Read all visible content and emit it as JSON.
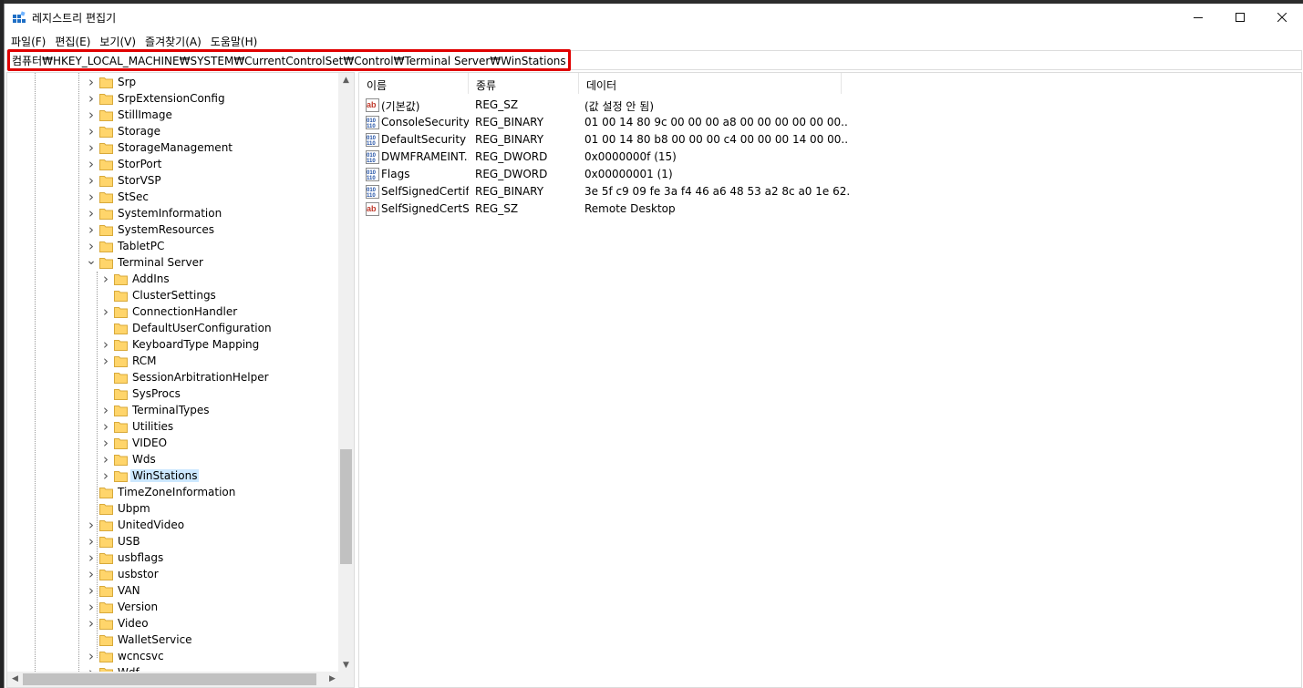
{
  "window": {
    "title": "레지스트리 편집기"
  },
  "menu": [
    "파일(F)",
    "편집(E)",
    "보기(V)",
    "즐겨찾기(A)",
    "도움말(H)"
  ],
  "address": "컴퓨터₩HKEY_LOCAL_MACHINE₩SYSTEM₩CurrentControlSet₩Control₩Terminal Server₩WinStations",
  "tree": [
    {
      "label": "Srp",
      "level": 1,
      "expander": "collapsed"
    },
    {
      "label": "SrpExtensionConfig",
      "level": 1,
      "expander": "collapsed"
    },
    {
      "label": "StillImage",
      "level": 1,
      "expander": "collapsed"
    },
    {
      "label": "Storage",
      "level": 1,
      "expander": "collapsed"
    },
    {
      "label": "StorageManagement",
      "level": 1,
      "expander": "collapsed"
    },
    {
      "label": "StorPort",
      "level": 1,
      "expander": "collapsed"
    },
    {
      "label": "StorVSP",
      "level": 1,
      "expander": "collapsed"
    },
    {
      "label": "StSec",
      "level": 1,
      "expander": "collapsed"
    },
    {
      "label": "SystemInformation",
      "level": 1,
      "expander": "collapsed"
    },
    {
      "label": "SystemResources",
      "level": 1,
      "expander": "collapsed"
    },
    {
      "label": "TabletPC",
      "level": 1,
      "expander": "collapsed"
    },
    {
      "label": "Terminal Server",
      "level": 1,
      "expander": "expanded"
    },
    {
      "label": "AddIns",
      "level": 2,
      "expander": "collapsed"
    },
    {
      "label": "ClusterSettings",
      "level": 2,
      "expander": "none"
    },
    {
      "label": "ConnectionHandler",
      "level": 2,
      "expander": "collapsed"
    },
    {
      "label": "DefaultUserConfiguration",
      "level": 2,
      "expander": "none"
    },
    {
      "label": "KeyboardType Mapping",
      "level": 2,
      "expander": "collapsed"
    },
    {
      "label": "RCM",
      "level": 2,
      "expander": "collapsed"
    },
    {
      "label": "SessionArbitrationHelper",
      "level": 2,
      "expander": "none"
    },
    {
      "label": "SysProcs",
      "level": 2,
      "expander": "none"
    },
    {
      "label": "TerminalTypes",
      "level": 2,
      "expander": "collapsed"
    },
    {
      "label": "Utilities",
      "level": 2,
      "expander": "collapsed"
    },
    {
      "label": "VIDEO",
      "level": 2,
      "expander": "collapsed"
    },
    {
      "label": "Wds",
      "level": 2,
      "expander": "collapsed"
    },
    {
      "label": "WinStations",
      "level": 2,
      "expander": "collapsed",
      "selected": true
    },
    {
      "label": "TimeZoneInformation",
      "level": 1,
      "expander": "none"
    },
    {
      "label": "Ubpm",
      "level": 1,
      "expander": "none"
    },
    {
      "label": "UnitedVideo",
      "level": 1,
      "expander": "collapsed"
    },
    {
      "label": "USB",
      "level": 1,
      "expander": "collapsed"
    },
    {
      "label": "usbflags",
      "level": 1,
      "expander": "collapsed"
    },
    {
      "label": "usbstor",
      "level": 1,
      "expander": "collapsed"
    },
    {
      "label": "VAN",
      "level": 1,
      "expander": "collapsed"
    },
    {
      "label": "Version",
      "level": 1,
      "expander": "collapsed"
    },
    {
      "label": "Video",
      "level": 1,
      "expander": "collapsed"
    },
    {
      "label": "WalletService",
      "level": 1,
      "expander": "none"
    },
    {
      "label": "wcncsvc",
      "level": 1,
      "expander": "collapsed"
    },
    {
      "label": "Wdf",
      "level": 1,
      "expander": "collapsed"
    }
  ],
  "columns": [
    "이름",
    "종류",
    "데이터"
  ],
  "values": [
    {
      "icon": "string",
      "name": "(기본값)",
      "type": "REG_SZ",
      "data": "(값 설정 안 됨)"
    },
    {
      "icon": "binary",
      "name": "ConsoleSecurity",
      "type": "REG_BINARY",
      "data": "01 00 14 80 9c 00 00 00 a8 00 00 00 00 00 00..."
    },
    {
      "icon": "binary",
      "name": "DefaultSecurity",
      "type": "REG_BINARY",
      "data": "01 00 14 80 b8 00 00 00 c4 00 00 00 14 00 00..."
    },
    {
      "icon": "binary",
      "name": "DWMFRAMEINT...",
      "type": "REG_DWORD",
      "data": "0x0000000f (15)"
    },
    {
      "icon": "binary",
      "name": "Flags",
      "type": "REG_DWORD",
      "data": "0x00000001 (1)"
    },
    {
      "icon": "binary",
      "name": "SelfSignedCertif...",
      "type": "REG_BINARY",
      "data": "3e 5f c9 09 fe 3a f4 46 a6 48 53 a2 8c a0 1e 62..."
    },
    {
      "icon": "string",
      "name": "SelfSignedCertS...",
      "type": "REG_SZ",
      "data": "Remote Desktop"
    }
  ],
  "colors": {
    "highlight": "#e00000",
    "selection": "#cce8ff",
    "folder": "#ffd56b"
  }
}
